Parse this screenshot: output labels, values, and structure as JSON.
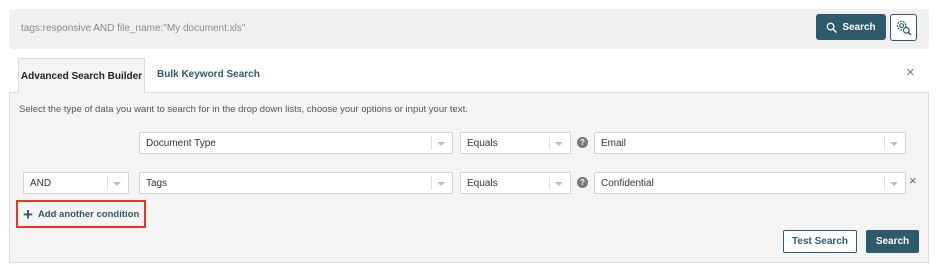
{
  "search_bar": {
    "query": "tags:responsive AND file_name:\"My document.xls\"",
    "search_label": "Search"
  },
  "tabs": [
    {
      "label": "Advanced Search Builder",
      "active": true
    },
    {
      "label": "Bulk Keyword Search",
      "active": false
    }
  ],
  "builder": {
    "instructions": "Select the type of data you want to search for in the drop down lists, choose your options or input your text.",
    "rows": [
      {
        "connector": "",
        "field": "Document Type",
        "operator": "Equals",
        "value": "Email"
      },
      {
        "connector": "AND",
        "field": "Tags",
        "operator": "Equals",
        "value": "Confidential"
      }
    ],
    "add_condition_label": "Add another condition",
    "help_glyph": "?",
    "close_glyph": "×"
  },
  "actions": {
    "test_label": "Test Search",
    "search_label": "Search"
  },
  "colors": {
    "accent": "#2d5b6b",
    "highlight": "#e8371f"
  }
}
